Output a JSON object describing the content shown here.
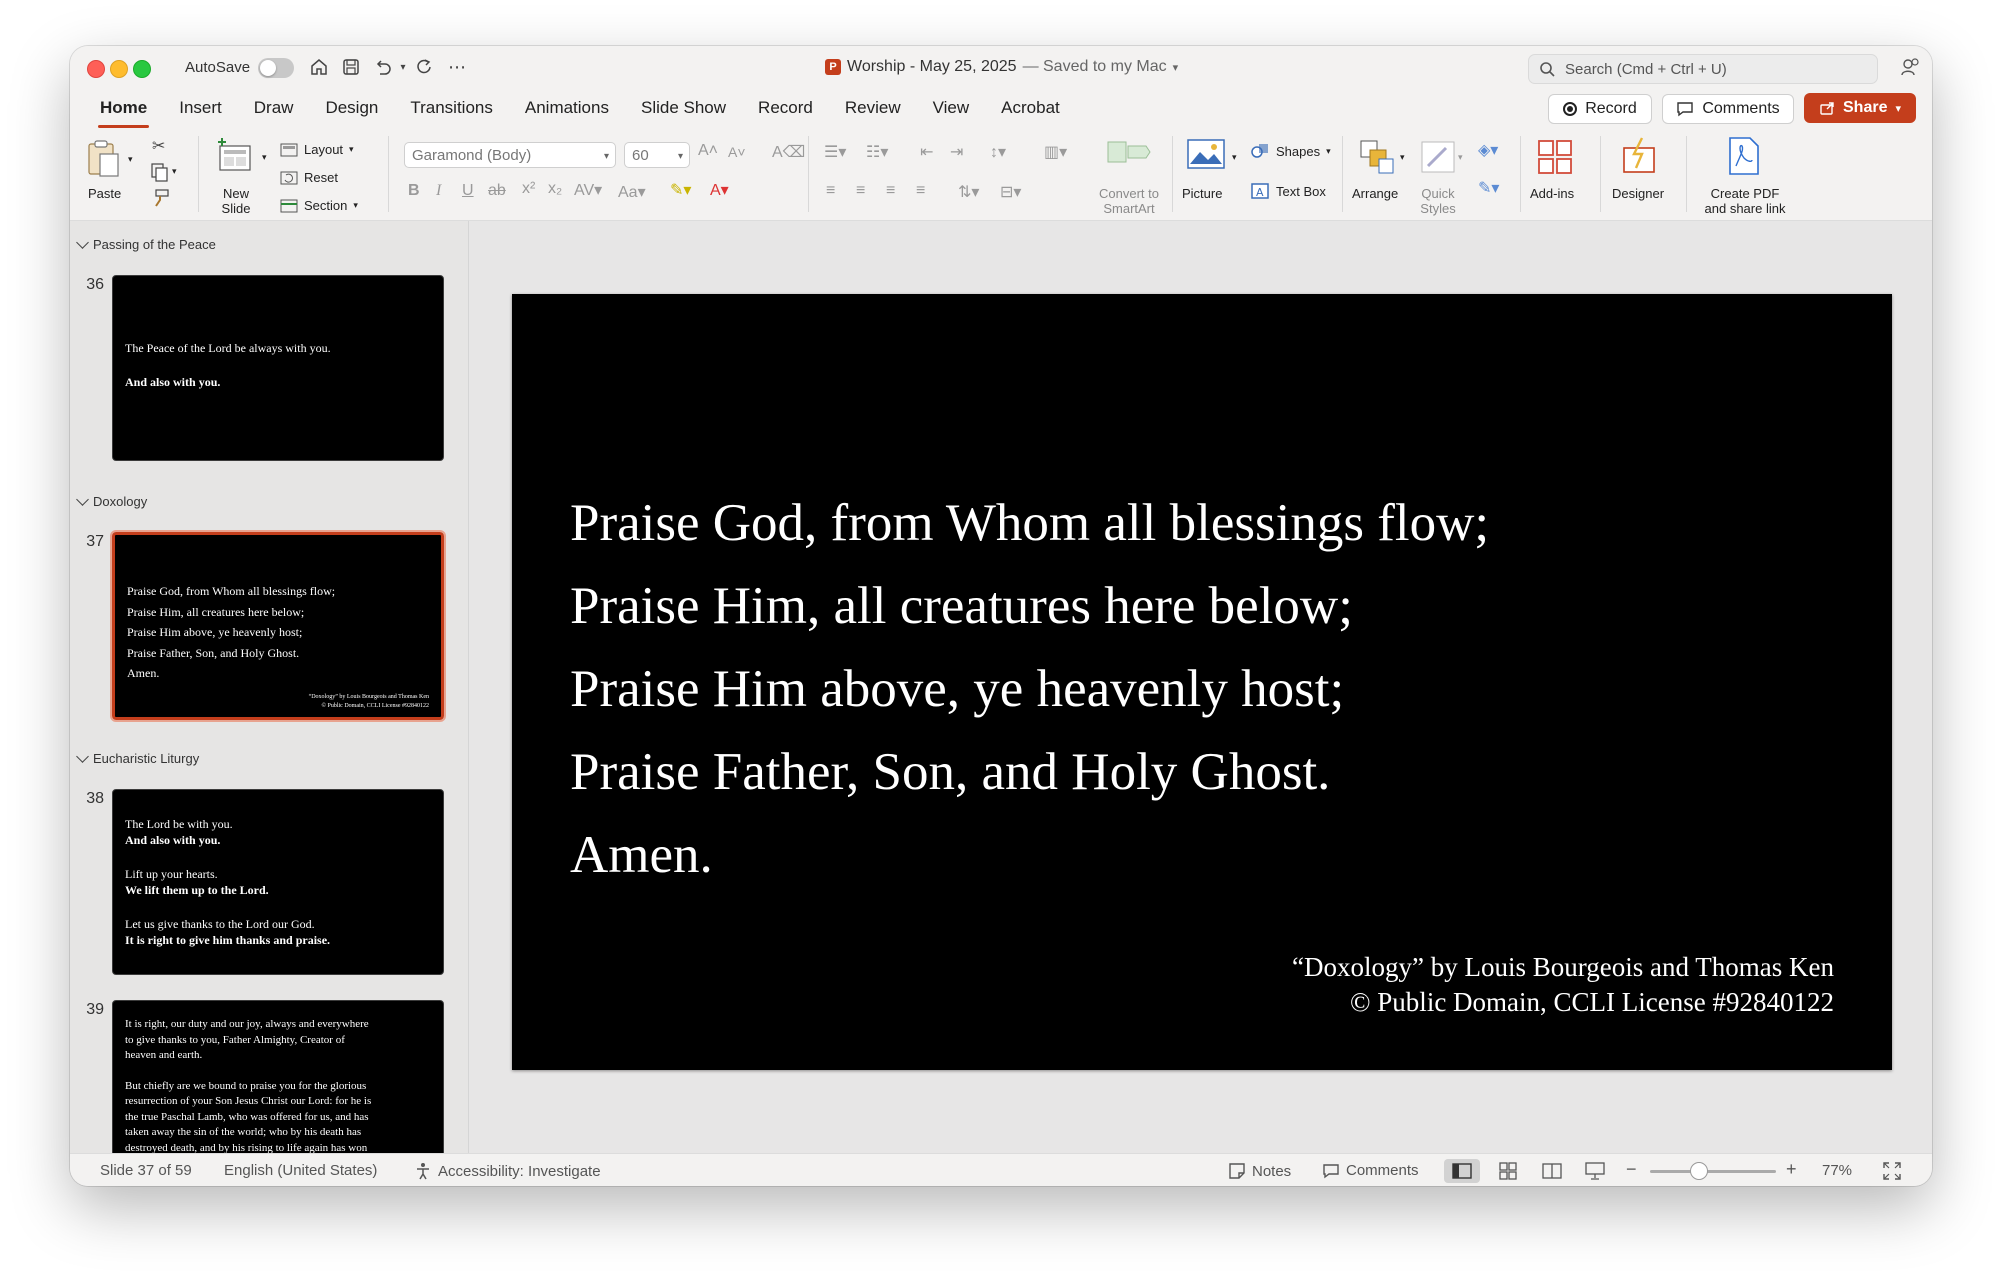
{
  "titlebar": {
    "autosave_label": "AutoSave",
    "document_title": "Worship - May 25, 2025",
    "save_status": "— Saved to my Mac",
    "search_placeholder": "Search (Cmd + Ctrl + U)"
  },
  "tabs": [
    "Home",
    "Insert",
    "Draw",
    "Design",
    "Transitions",
    "Animations",
    "Slide Show",
    "Record",
    "Review",
    "View",
    "Acrobat"
  ],
  "active_tab": "Home",
  "header_buttons": {
    "record": "Record",
    "comments": "Comments",
    "share": "Share"
  },
  "ribbon": {
    "paste": "Paste",
    "new_slide": "New Slide",
    "layout": "Layout",
    "reset": "Reset",
    "section": "Section",
    "font_name": "Garamond (Body)",
    "font_size": "60",
    "convert_smartart": "Convert to SmartArt",
    "picture": "Picture",
    "shapes": "Shapes",
    "text_box": "Text Box",
    "arrange": "Arrange",
    "quick_styles": "Quick Styles",
    "add_ins": "Add-ins",
    "designer": "Designer",
    "create_pdf": "Create PDF and share link"
  },
  "thumbnails": {
    "sections": [
      "Passing of the Peace",
      "Doxology",
      "Eucharistic Liturgy"
    ],
    "slides": [
      {
        "number": "36",
        "lines": [
          "The Peace of the Lord be always with you.",
          "And also with you."
        ]
      },
      {
        "number": "37",
        "lines": [
          "Praise God, from Whom all blessings flow;",
          "Praise Him, all creatures here below;",
          "Praise Him above, ye heavenly host;",
          "Praise Father, Son, and Holy Ghost.",
          "Amen."
        ],
        "credit": [
          "“Doxology” by Louis Bourgeois and Thomas Ken",
          "© Public Domain, CCLI License #92840122"
        ]
      },
      {
        "number": "38",
        "lines": [
          "The Lord be with you.",
          "And also with you.",
          "Lift up your hearts.",
          "We lift them up to the Lord.",
          "Let us give thanks to the Lord our God.",
          "It is right to give him thanks and praise."
        ]
      },
      {
        "number": "39",
        "lines": [
          "It is right, our duty and our joy, always and everywhere",
          "to give thanks to you, Father Almighty, Creator of",
          "heaven and earth.",
          "But chiefly are we bound to praise you for the glorious",
          "resurrection of your Son Jesus Christ our Lord: for he is",
          "the true Paschal Lamb, who was offered for us, and has",
          "taken away the sin of the world; who by his death has",
          "destroyed death, and by his rising to life again has won"
        ]
      }
    ]
  },
  "slide": {
    "lines": [
      "Praise God, from Whom all blessings flow;",
      "Praise Him, all creatures here below;",
      "Praise Him above, ye heavenly host;",
      "Praise Father, Son, and Holy Ghost.",
      "Amen."
    ],
    "credit": [
      "“Doxology” by Louis Bourgeois and Thomas Ken",
      "© Public Domain, CCLI License #92840122"
    ]
  },
  "statusbar": {
    "slide_count": "Slide 37 of 59",
    "language": "English (United States)",
    "accessibility": "Accessibility: Investigate",
    "notes": "Notes",
    "comments": "Comments",
    "zoom": "77%"
  },
  "colors": {
    "accent": "#c43e1c",
    "slide_bg": "#000000"
  }
}
